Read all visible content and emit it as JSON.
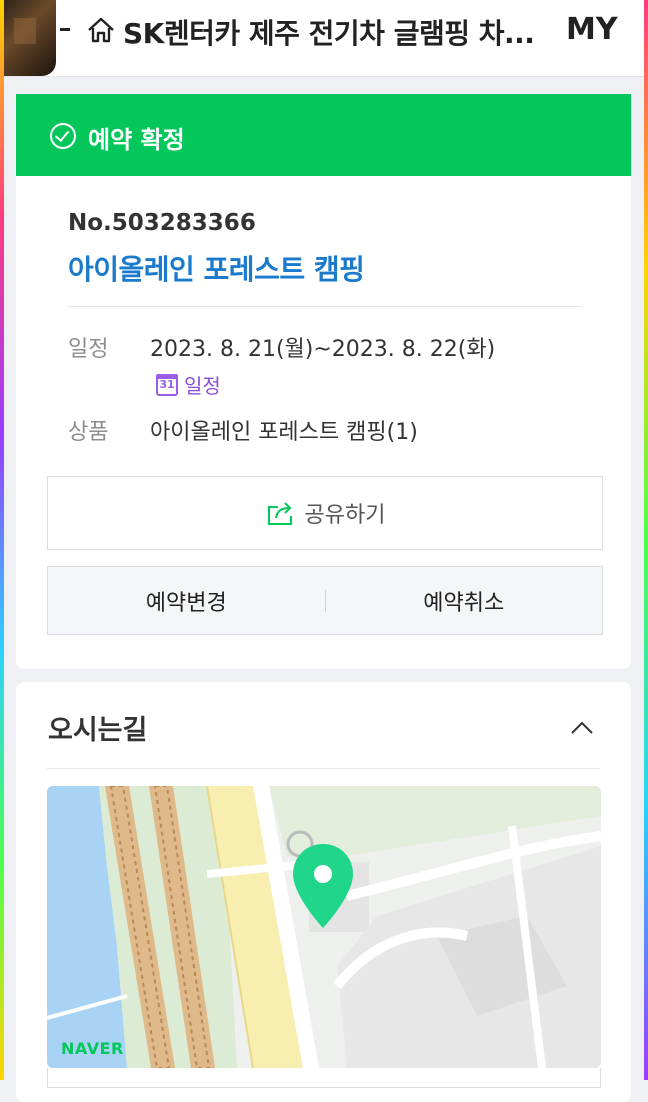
{
  "header": {
    "title": "SK렌터카 제주 전기차 글램핑 차...",
    "my_label": "MY"
  },
  "status": {
    "label": "예약 확정",
    "color": "#03c75a"
  },
  "reservation": {
    "number": "No.503283366",
    "name": "아이올레인 포레스트 캠핑",
    "schedule_label": "일정",
    "schedule_value": "2023. 8. 21(월)~2023. 8. 22(화)",
    "calendar_link": "일정",
    "calendar_icon_day": "31",
    "product_label": "상품",
    "product_value": "아이올레인 포레스트 캠핑(1)"
  },
  "actions": {
    "share": "공유하기",
    "change": "예약변경",
    "cancel": "예약취소"
  },
  "directions": {
    "title": "오시는길",
    "map_logo": "NAVER"
  },
  "colors": {
    "accent_blue": "#1a7acb",
    "accent_purple": "#8a4fd9",
    "pin_green": "#1fd68a"
  }
}
